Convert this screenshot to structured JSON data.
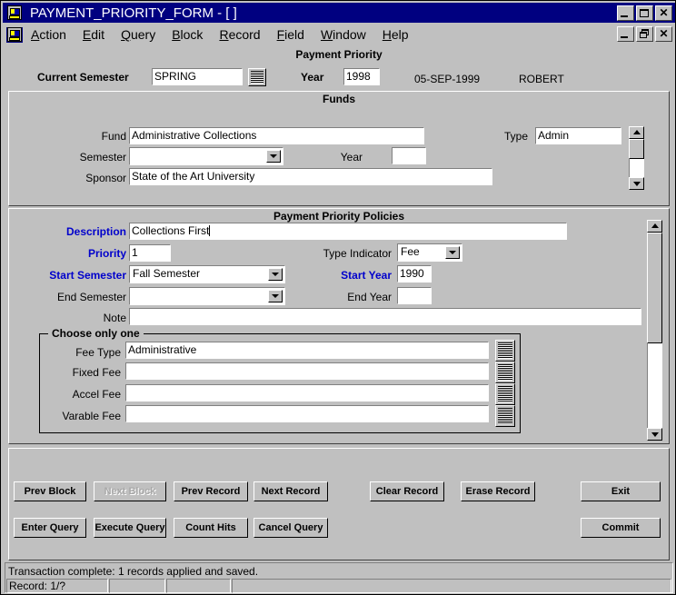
{
  "window": {
    "title": "PAYMENT_PRIORITY_FORM - [ ]",
    "icon": "form-app-icon",
    "controls": {
      "minimize": "_",
      "maximize": "□",
      "close": "✕"
    }
  },
  "menubar": {
    "icon": "form-app-icon",
    "items": [
      {
        "label": "Action",
        "accel": "A"
      },
      {
        "label": "Edit",
        "accel": "E"
      },
      {
        "label": "Query",
        "accel": "Q"
      },
      {
        "label": "Block",
        "accel": "B"
      },
      {
        "label": "Record",
        "accel": "R"
      },
      {
        "label": "Field",
        "accel": "F"
      },
      {
        "label": "Window",
        "accel": "W"
      },
      {
        "label": "Help",
        "accel": "H"
      }
    ],
    "mdi_controls": {
      "minimize": "_",
      "restore": "❐",
      "close": "✕"
    }
  },
  "header": {
    "form_title": "Payment Priority",
    "current_semester_label": "Current Semester",
    "current_semester_value": "SPRING",
    "current_semester_lov": "list-of-values-icon",
    "year_label": "Year",
    "year_value": "1998",
    "date": "05-SEP-1999",
    "user": "ROBERT"
  },
  "funds": {
    "title": "Funds",
    "fund_label": "Fund",
    "fund_value": "Administrative Collections",
    "semester_label": "Semester",
    "semester_value": "",
    "year_label": "Year",
    "year_value": "",
    "sponsor_label": "Sponsor",
    "sponsor_value": "State of the Art University",
    "type_label": "Type",
    "type_value": "Admin"
  },
  "policies": {
    "title": "Payment Priority Policies",
    "description_label": "Description",
    "description_value": "Collections First",
    "priority_label": "Priority",
    "priority_value": "1",
    "type_indicator_label": "Type Indicator",
    "type_indicator_value": "Fee",
    "start_semester_label": "Start Semester",
    "start_semester_value": "Fall Semester",
    "start_year_label": "Start Year",
    "start_year_value": "1990",
    "end_semester_label": "End Semester",
    "end_semester_value": "",
    "end_year_label": "End Year",
    "end_year_value": "",
    "note_label": "Note",
    "note_value": "",
    "choose_group": {
      "legend": "Choose only one",
      "rows": [
        {
          "label": "Fee Type",
          "value": "Administrative",
          "lov": "list-of-values-icon"
        },
        {
          "label": "Fixed Fee",
          "value": "",
          "lov": "list-of-values-icon"
        },
        {
          "label": "Accel Fee",
          "value": "",
          "lov": "list-of-values-icon"
        },
        {
          "label": "Varable Fee",
          "value": "",
          "lov": "list-of-values-icon"
        }
      ]
    }
  },
  "buttons": {
    "row1": [
      {
        "label": "Prev Block",
        "enabled": true
      },
      {
        "label": "Next Block",
        "enabled": false
      },
      {
        "label": "Prev Record",
        "enabled": true
      },
      {
        "label": "Next Record",
        "enabled": true
      },
      {
        "label": "Clear Record",
        "enabled": true
      },
      {
        "label": "Erase Record",
        "enabled": true
      },
      {
        "label": "Exit",
        "enabled": true
      }
    ],
    "row2": [
      {
        "label": "Enter Query",
        "enabled": true
      },
      {
        "label": "Execute Query",
        "enabled": true
      },
      {
        "label": "Count Hits",
        "enabled": true
      },
      {
        "label": "Cancel Query",
        "enabled": true
      },
      {
        "label": "Commit",
        "enabled": true
      }
    ]
  },
  "status": {
    "message": "Transaction complete: 1 records applied and saved.",
    "record": "Record: 1/?",
    "cell2": "",
    "cell3": "",
    "cell4": ""
  },
  "colors": {
    "titlebar": "#000080",
    "face": "#c0c0c0",
    "required_label": "#0000cc",
    "field_bg": "#ffffff"
  }
}
